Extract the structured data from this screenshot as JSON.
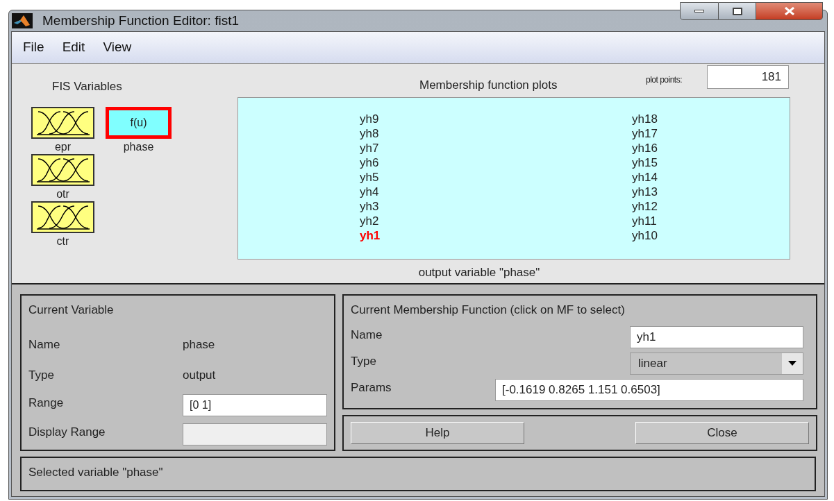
{
  "window": {
    "title": "Membership Function Editor: fist1"
  },
  "menu": [
    "File",
    "Edit",
    "View"
  ],
  "fis_variables": {
    "title": "FIS Variables",
    "items": [
      {
        "name": "epr",
        "kind": "input",
        "selected": false
      },
      {
        "name": "otr",
        "kind": "input",
        "selected": false
      },
      {
        "name": "ctr",
        "kind": "input",
        "selected": false
      },
      {
        "name": "phase",
        "kind": "output",
        "selected": true,
        "symbol": "f(u)"
      }
    ]
  },
  "plot": {
    "title": "Membership function plots",
    "plot_points_label": "plot points:",
    "plot_points": "181",
    "caption": "output variable \"phase\"",
    "columns": [
      [
        {
          "label": "yh9",
          "selected": false
        },
        {
          "label": "yh8",
          "selected": false
        },
        {
          "label": "yh7",
          "selected": false
        },
        {
          "label": "yh6",
          "selected": false
        },
        {
          "label": "yh5",
          "selected": false
        },
        {
          "label": "yh4",
          "selected": false
        },
        {
          "label": "yh3",
          "selected": false
        },
        {
          "label": "yh2",
          "selected": false
        },
        {
          "label": "yh1",
          "selected": true
        }
      ],
      [
        {
          "label": "yh18",
          "selected": false
        },
        {
          "label": "yh17",
          "selected": false
        },
        {
          "label": "yh16",
          "selected": false
        },
        {
          "label": "yh15",
          "selected": false
        },
        {
          "label": "yh14",
          "selected": false
        },
        {
          "label": "yh13",
          "selected": false
        },
        {
          "label": "yh12",
          "selected": false
        },
        {
          "label": "yh11",
          "selected": false
        },
        {
          "label": "yh10",
          "selected": false
        }
      ]
    ]
  },
  "current_variable": {
    "title": "Current Variable",
    "name_label": "Name",
    "name": "phase",
    "type_label": "Type",
    "type": "output",
    "range_label": "Range",
    "range": "[0 1]",
    "display_range_label": "Display Range"
  },
  "current_mf": {
    "title": "Current Membership Function (click on MF to select)",
    "name_label": "Name",
    "name": "yh1",
    "type_label": "Type",
    "type": "linear",
    "params_label": "Params",
    "params": "[-0.1619 0.8265 1.151 0.6503]"
  },
  "buttons": [
    "Help",
    "Close"
  ],
  "status": "Selected variable \"phase\""
}
